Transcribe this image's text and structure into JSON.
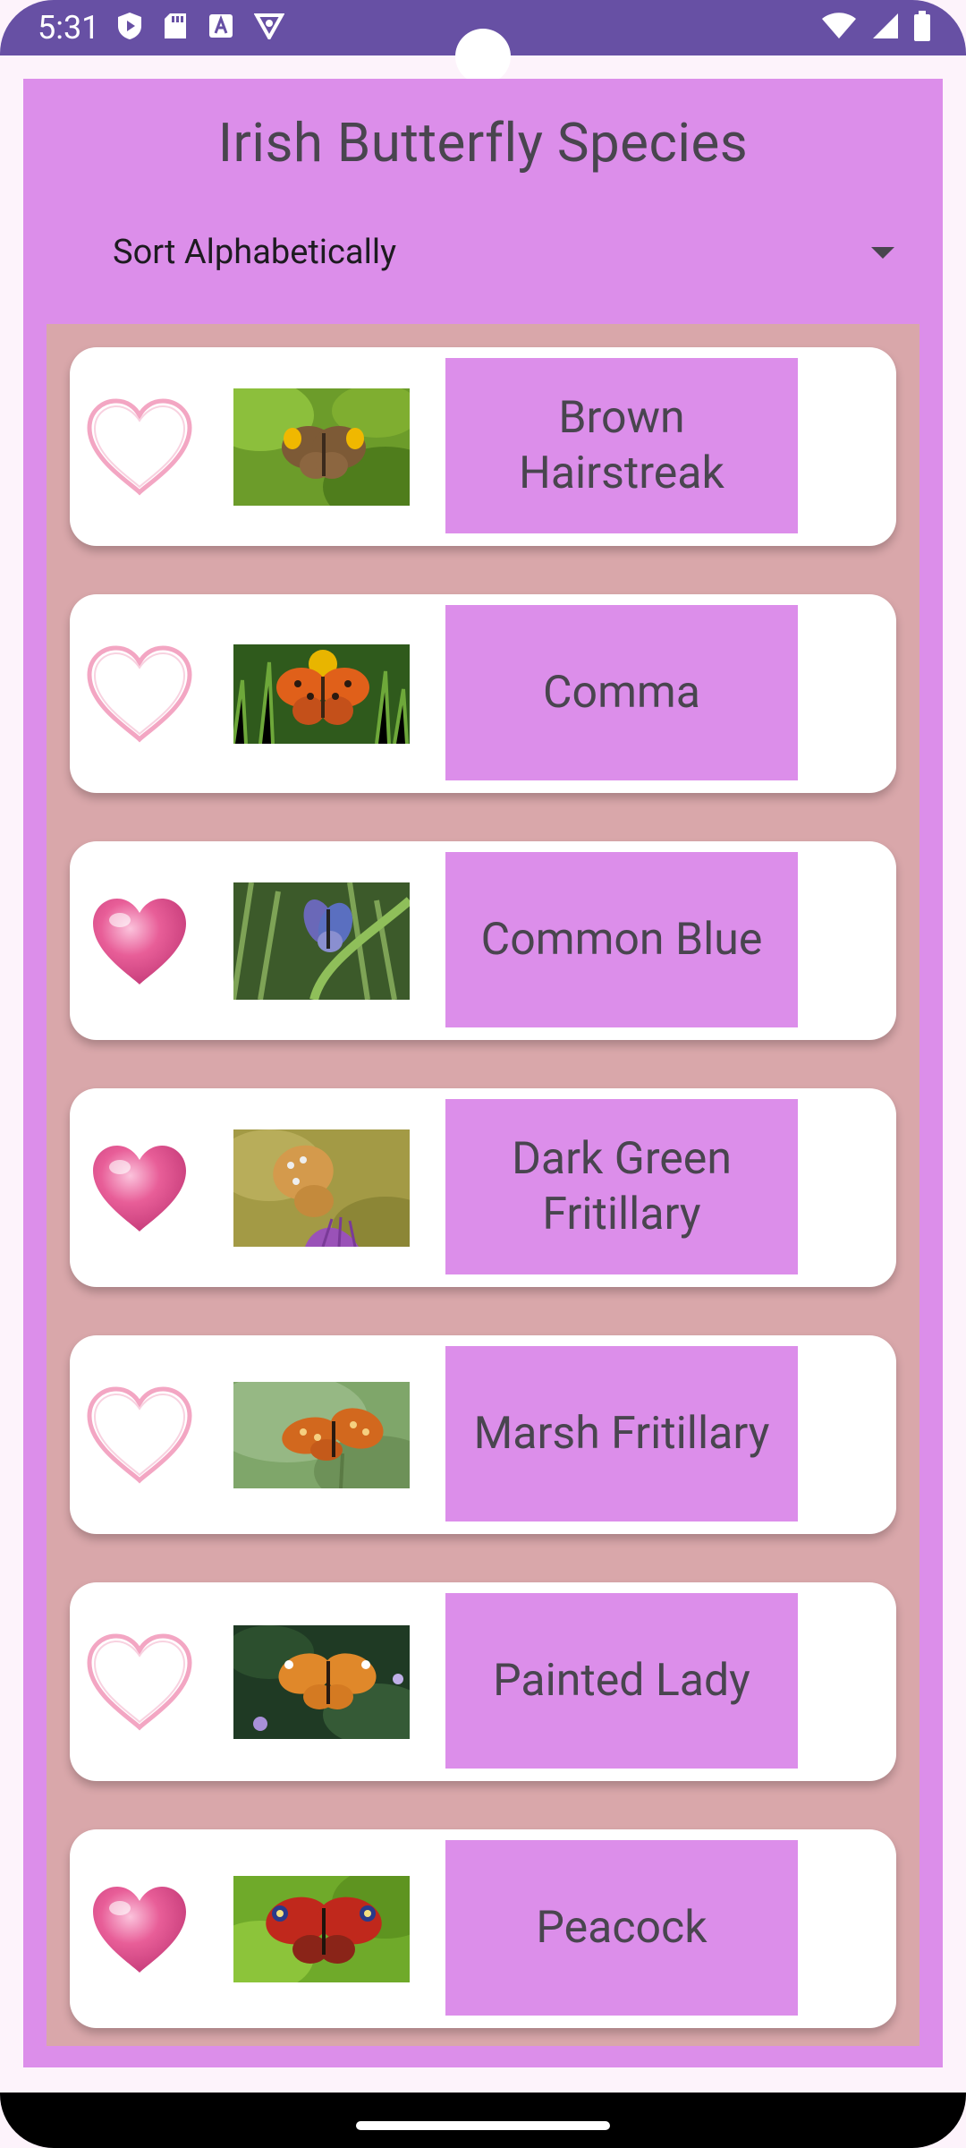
{
  "status_bar": {
    "time": "5:31",
    "left_icons": [
      "play-protect-icon",
      "sd-card-icon",
      "keyboard-a-icon",
      "vpn-shield-icon"
    ],
    "right_icons": [
      "wifi-icon",
      "signal-icon",
      "battery-icon"
    ],
    "color": "#6750a4"
  },
  "header": {
    "title": "Irish Butterfly Species",
    "sort_selected": "Sort Alphabetically"
  },
  "colors": {
    "panel": "#dc8eea",
    "list_bg": "#d9a7aa",
    "heart": "#e26f9d"
  },
  "butterflies": [
    {
      "name": "Brown Hairstreak",
      "favorite": false,
      "image": "brown-hairstreak-photo"
    },
    {
      "name": "Comma",
      "favorite": false,
      "image": "comma-photo"
    },
    {
      "name": "Common Blue",
      "favorite": true,
      "image": "common-blue-photo"
    },
    {
      "name": "Dark Green Fritillary",
      "favorite": true,
      "image": "dark-green-fritillary-photo"
    },
    {
      "name": "Marsh Fritillary",
      "favorite": false,
      "image": "marsh-fritillary-photo"
    },
    {
      "name": "Painted Lady",
      "favorite": false,
      "image": "painted-lady-photo"
    },
    {
      "name": "Peacock",
      "favorite": true,
      "image": "peacock-photo"
    }
  ]
}
